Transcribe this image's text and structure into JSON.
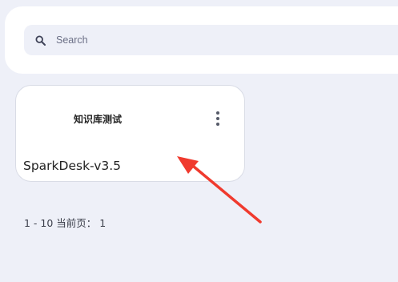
{
  "search": {
    "placeholder": "Search",
    "icon": "search-icon"
  },
  "cards": [
    {
      "title": "知识库测试",
      "model": "SparkDesk-v3.5",
      "menu_icon": "more-vert-icon"
    }
  ],
  "pagination": {
    "text": "1 - 10 当前页： 1"
  },
  "colors": {
    "background": "#eef0f8",
    "panel": "#ffffff",
    "annotation_arrow": "#f03a2e"
  }
}
